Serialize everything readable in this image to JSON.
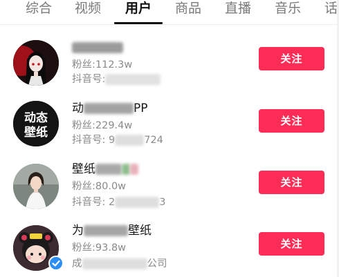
{
  "tabs": [
    {
      "label": "综合",
      "active": false
    },
    {
      "label": "视频",
      "active": false
    },
    {
      "label": "用户",
      "active": true
    },
    {
      "label": "商品",
      "active": false
    },
    {
      "label": "直播",
      "active": false
    },
    {
      "label": "音乐",
      "active": false
    },
    {
      "label": "话",
      "active": false
    }
  ],
  "colors": {
    "accent": "#fb2c56",
    "verified": "#2c8ff5"
  },
  "users": [
    {
      "name_visible": "",
      "fans": "粉丝:112.3w",
      "id_prefix": "抖音号:",
      "id_suffix": "",
      "follow_label": "关注",
      "avatar_text": "",
      "avatar_icon": "anime-girl-avatar",
      "verified": false
    },
    {
      "name_visible": "动",
      "name_tail": "PP",
      "fans": "粉丝:229.4w",
      "id_prefix": "抖音号: 9",
      "id_suffix": "724",
      "follow_label": "关注",
      "avatar_text": "动态\n壁纸",
      "avatar_icon": "text-logo-avatar",
      "verified": false
    },
    {
      "name_visible": "壁纸",
      "fans": "粉丝:80.0w",
      "id_prefix": "抖音号: 2",
      "id_suffix": "3",
      "follow_label": "关注",
      "avatar_text": "",
      "avatar_icon": "photo-woman-avatar",
      "verified": false
    },
    {
      "name_visible": "为",
      "name_tail": "壁纸",
      "fans": "粉丝:93.8w",
      "id_prefix": "成",
      "id_suffix": "公司",
      "follow_label": "关注",
      "avatar_text": "",
      "avatar_icon": "cartoon-girl-avatar",
      "verified": true,
      "verified_icon": "verified-check-icon"
    }
  ]
}
